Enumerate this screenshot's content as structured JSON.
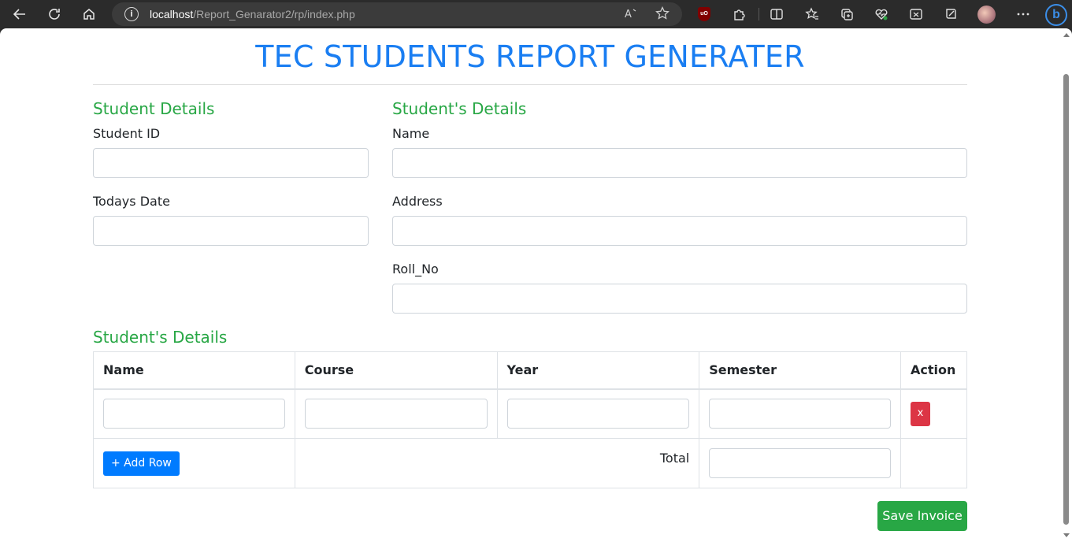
{
  "browser": {
    "url_host": "localhost",
    "url_path": "/Report_Genarator2/rp/index.php",
    "icons": [
      "back-icon",
      "refresh-icon",
      "home-icon",
      "site-info-icon",
      "read-aloud-icon",
      "favorite-star-icon",
      "ublock-icon",
      "extensions-icon",
      "split-screen-icon",
      "favorites-icon",
      "collections-icon",
      "performance-icon",
      "web-capture-icon",
      "browser-essentials-icon",
      "profile-avatar",
      "more-icon",
      "bing-copilot-icon"
    ],
    "ublock_text": "uO",
    "bing_text": "b"
  },
  "page": {
    "title": "TEC STUDENTS REPORT GENERATER",
    "title_color": "#1a7ef2",
    "section_color": "#28a745",
    "left_section": {
      "heading": "Student Details",
      "fields": [
        {
          "label": "Student ID",
          "value": ""
        },
        {
          "label": "Todays Date",
          "value": ""
        }
      ]
    },
    "right_section": {
      "heading": "Student's Details",
      "fields": [
        {
          "label": "Name",
          "value": ""
        },
        {
          "label": "Address",
          "value": ""
        },
        {
          "label": "Roll_No",
          "value": ""
        }
      ]
    },
    "table_section": {
      "heading": "Student's Details",
      "columns": [
        "Name",
        "Course",
        "Year",
        "Semester",
        "Action"
      ],
      "rows": [
        {
          "name": "",
          "course": "",
          "year": "",
          "semester": ""
        }
      ],
      "delete_label": "x",
      "add_row_label": "+ Add Row",
      "total_label": "Total",
      "total_value": ""
    },
    "save_label": "Save Invoice",
    "colors": {
      "danger": "#dc3545",
      "primary": "#007bff",
      "success": "#28a745"
    }
  }
}
